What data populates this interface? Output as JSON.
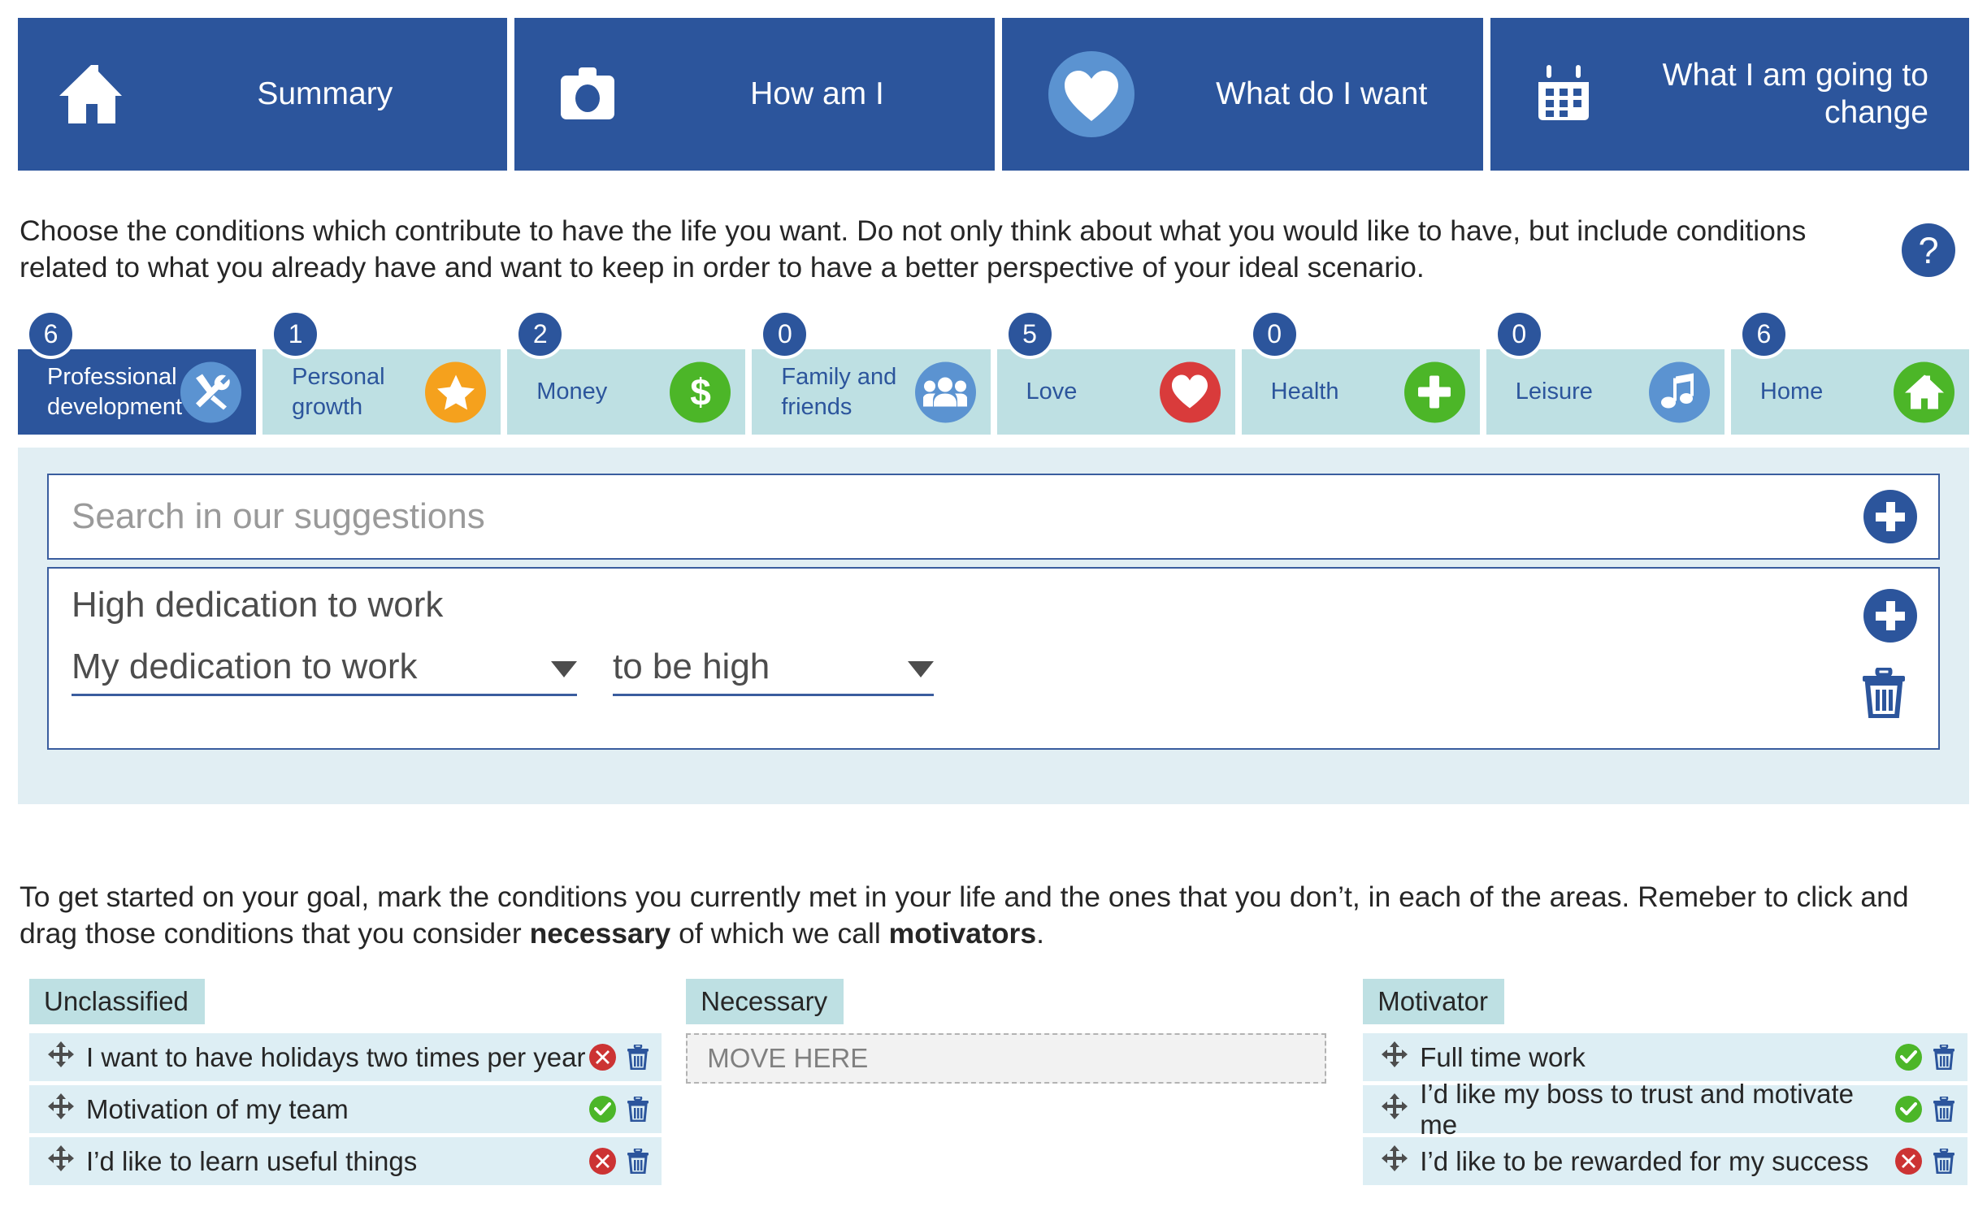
{
  "topnav": {
    "items": [
      {
        "label": "Summary",
        "icon": "home-icon"
      },
      {
        "label": "How am I",
        "icon": "camera-icon"
      },
      {
        "label": "What do I want",
        "icon": "heart-icon"
      },
      {
        "label": "What I am going to change",
        "icon": "calendar-icon"
      }
    ]
  },
  "intro": {
    "text": "Choose the conditions which contribute to have the life you want. Do not only think about what you would like to have, but include conditions related to what you already have and want to keep in order to have a better perspective of your ideal scenario.",
    "help_icon": "question-mark-icon"
  },
  "categories": [
    {
      "label": "Professional development",
      "count": "6",
      "icon": "tools-icon",
      "icon_bg": "#5b93d1",
      "active": true
    },
    {
      "label": "Personal growth",
      "count": "1",
      "icon": "star-icon",
      "icon_bg": "#f5a11d",
      "active": false
    },
    {
      "label": "Money",
      "count": "2",
      "icon": "dollar-icon",
      "icon_bg": "#4cb628",
      "active": false
    },
    {
      "label": "Family and friends",
      "count": "0",
      "icon": "people-icon",
      "icon_bg": "#5b93d1",
      "active": false
    },
    {
      "label": "Love",
      "count": "5",
      "icon": "heart-icon",
      "icon_bg": "#d93b3b",
      "active": false
    },
    {
      "label": "Health",
      "count": "0",
      "icon": "plus-icon",
      "icon_bg": "#4cb628",
      "active": false
    },
    {
      "label": "Leisure",
      "count": "0",
      "icon": "music-icon",
      "icon_bg": "#5b93d1",
      "active": false
    },
    {
      "label": "Home",
      "count": "6",
      "icon": "home-icon",
      "icon_bg": "#4cb628",
      "active": false
    }
  ],
  "panel": {
    "search_placeholder": "Search in our suggestions",
    "search_value": "",
    "add_suggestion_icon": "plus-circle-icon",
    "condition": {
      "title": "High dedication to work",
      "subject_value": "My dedication to work",
      "predicate_value": "to be high",
      "add_icon": "plus-circle-icon",
      "delete_icon": "trash-icon"
    }
  },
  "intro2": {
    "part1": "To get started on your goal, mark the conditions you currently met in your life and the ones that you don’t, in each of the areas. Remeber to click and drag those conditions that you consider ",
    "bold1": "necessary",
    "part2": " of which we call ",
    "bold2": "motivators",
    "part3": "."
  },
  "columns": [
    {
      "title": "Unclassified",
      "rows": [
        {
          "label": "I want to have holidays two times per year",
          "status": "no",
          "drag_icon": "move-icon",
          "delete_icon": "trash-icon"
        },
        {
          "label": "Motivation of my team",
          "status": "yes",
          "drag_icon": "move-icon",
          "delete_icon": "trash-icon"
        },
        {
          "label": "I’d like to learn useful things",
          "status": "no",
          "drag_icon": "move-icon",
          "delete_icon": "trash-icon"
        }
      ],
      "dropzone": null
    },
    {
      "title": "Necessary",
      "rows": [],
      "dropzone": "MOVE HERE"
    },
    {
      "title": "Motivator",
      "rows": [
        {
          "label": "Full time work",
          "status": "yes",
          "drag_icon": "move-icon",
          "delete_icon": "trash-icon"
        },
        {
          "label": "I’d like my boss to trust and motivate me",
          "status": "yes",
          "drag_icon": "move-icon",
          "delete_icon": "trash-icon"
        },
        {
          "label": "I’d like to be rewarded for my success",
          "status": "no",
          "drag_icon": "move-icon",
          "delete_icon": "trash-icon"
        }
      ],
      "dropzone": null
    }
  ],
  "colors": {
    "brand_blue": "#2c559c",
    "tab_teal": "#bee0e3",
    "panel_bg": "#e1eef3",
    "row_bg": "#ddeef4",
    "green": "#4cb628",
    "red": "#cc3333"
  }
}
